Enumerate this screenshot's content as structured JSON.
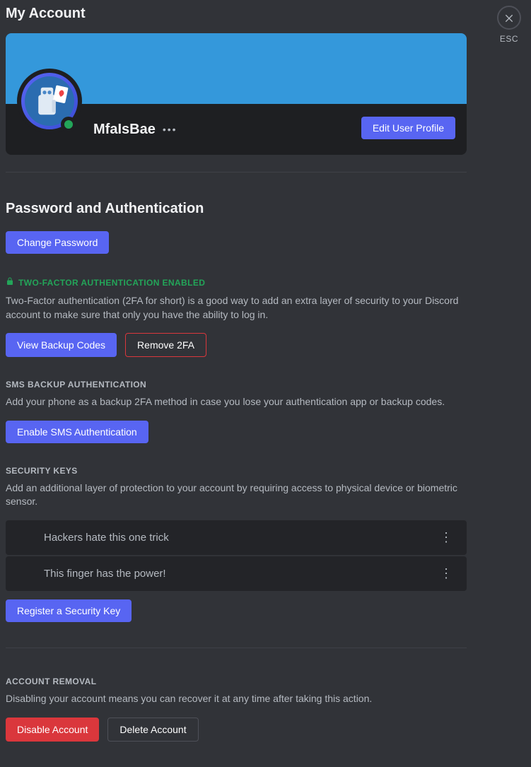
{
  "page": {
    "title": "My Account",
    "escLabel": "ESC"
  },
  "profile": {
    "username": "MfaIsBae",
    "editBtn": "Edit User Profile",
    "bannerColor": "#3498db"
  },
  "password": {
    "sectionTitle": "Password and Authentication",
    "changeBtn": "Change Password"
  },
  "twofa": {
    "heading": "TWO-FACTOR AUTHENTICATION ENABLED",
    "desc": "Two-Factor authentication (2FA for short) is a good way to add an extra layer of security to your Discord account to make sure that only you have the ability to log in.",
    "viewBackupBtn": "View Backup Codes",
    "removeBtn": "Remove 2FA"
  },
  "sms": {
    "heading": "SMS BACKUP AUTHENTICATION",
    "desc": "Add your phone as a backup 2FA method in case you lose your authentication app or backup codes.",
    "enableBtn": "Enable SMS Authentication"
  },
  "securityKeys": {
    "heading": "SECURITY KEYS",
    "desc": "Add an additional layer of protection to your account by requiring access to physical device or biometric sensor.",
    "items": [
      {
        "name": "Hackers hate this one trick"
      },
      {
        "name": "This finger has the power!"
      }
    ],
    "registerBtn": "Register a Security Key"
  },
  "removal": {
    "heading": "ACCOUNT REMOVAL",
    "desc": "Disabling your account means you can recover it at any time after taking this action.",
    "disableBtn": "Disable Account",
    "deleteBtn": "Delete Account"
  }
}
